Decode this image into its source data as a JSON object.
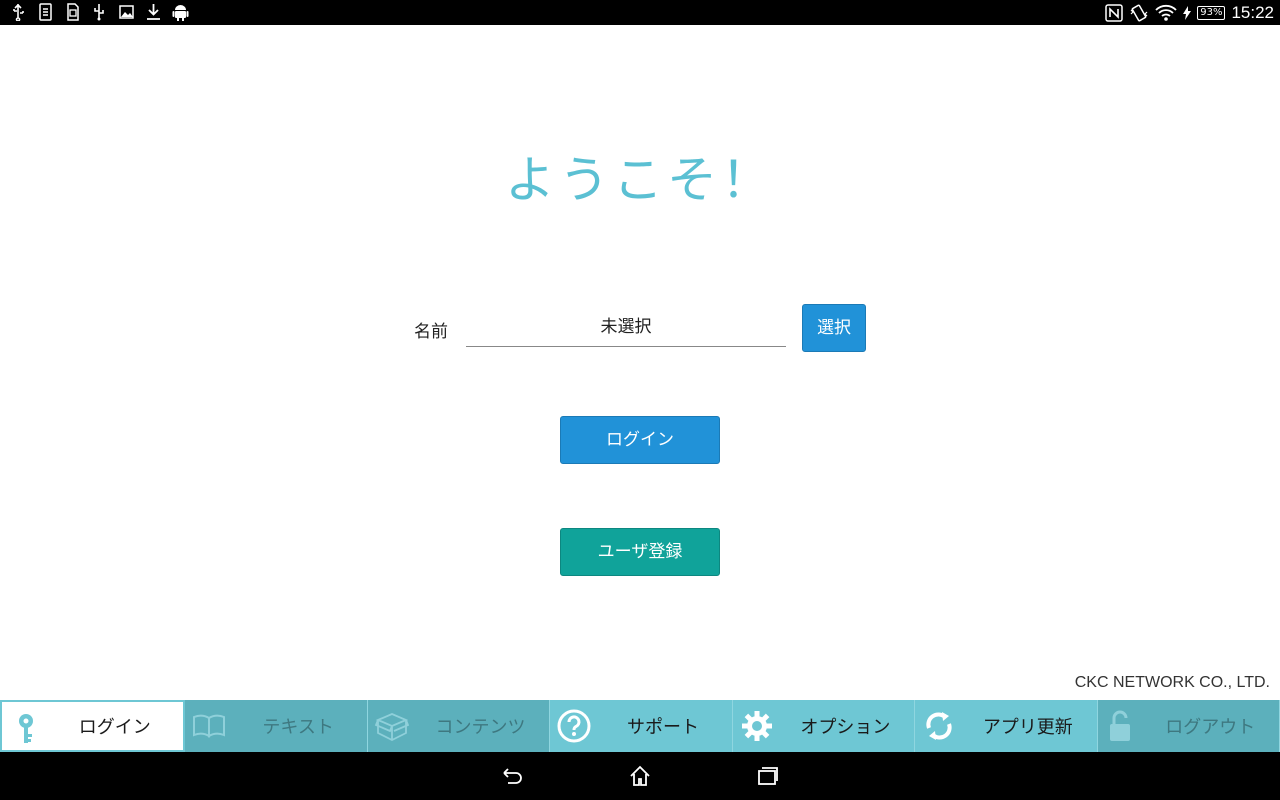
{
  "status_bar": {
    "left_icons": [
      "usb-icon",
      "sim-card-icon",
      "sd-card-icon",
      "usb-debug-icon",
      "image-icon",
      "download-icon",
      "android-icon"
    ],
    "right_icons": [
      "nfc-icon",
      "vibrate-icon",
      "wifi-icon",
      "charging-icon"
    ],
    "battery": "93%",
    "time": "15:22"
  },
  "main": {
    "welcome": "ようこそ！",
    "name_label": "名前",
    "name_value": "未選択",
    "select_button": "選択",
    "login_button": "ログイン",
    "register_button": "ユーザ登録"
  },
  "copyright": "CKC NETWORK CO., LTD.",
  "tabs": [
    {
      "label": "ログイン",
      "icon": "key-icon"
    },
    {
      "label": "テキスト",
      "icon": "book-icon"
    },
    {
      "label": "コンテンツ",
      "icon": "box-icon"
    },
    {
      "label": "サポート",
      "icon": "help-icon"
    },
    {
      "label": "オプション",
      "icon": "gear-icon"
    },
    {
      "label": "アプリ更新",
      "icon": "refresh-icon"
    },
    {
      "label": "ログアウト",
      "icon": "unlock-icon"
    }
  ],
  "colors": {
    "accent_blue": "#2192d8",
    "accent_teal": "#10a39a",
    "welcome_color": "#5bc0d3",
    "tab_bg": "#6ec7d4"
  }
}
